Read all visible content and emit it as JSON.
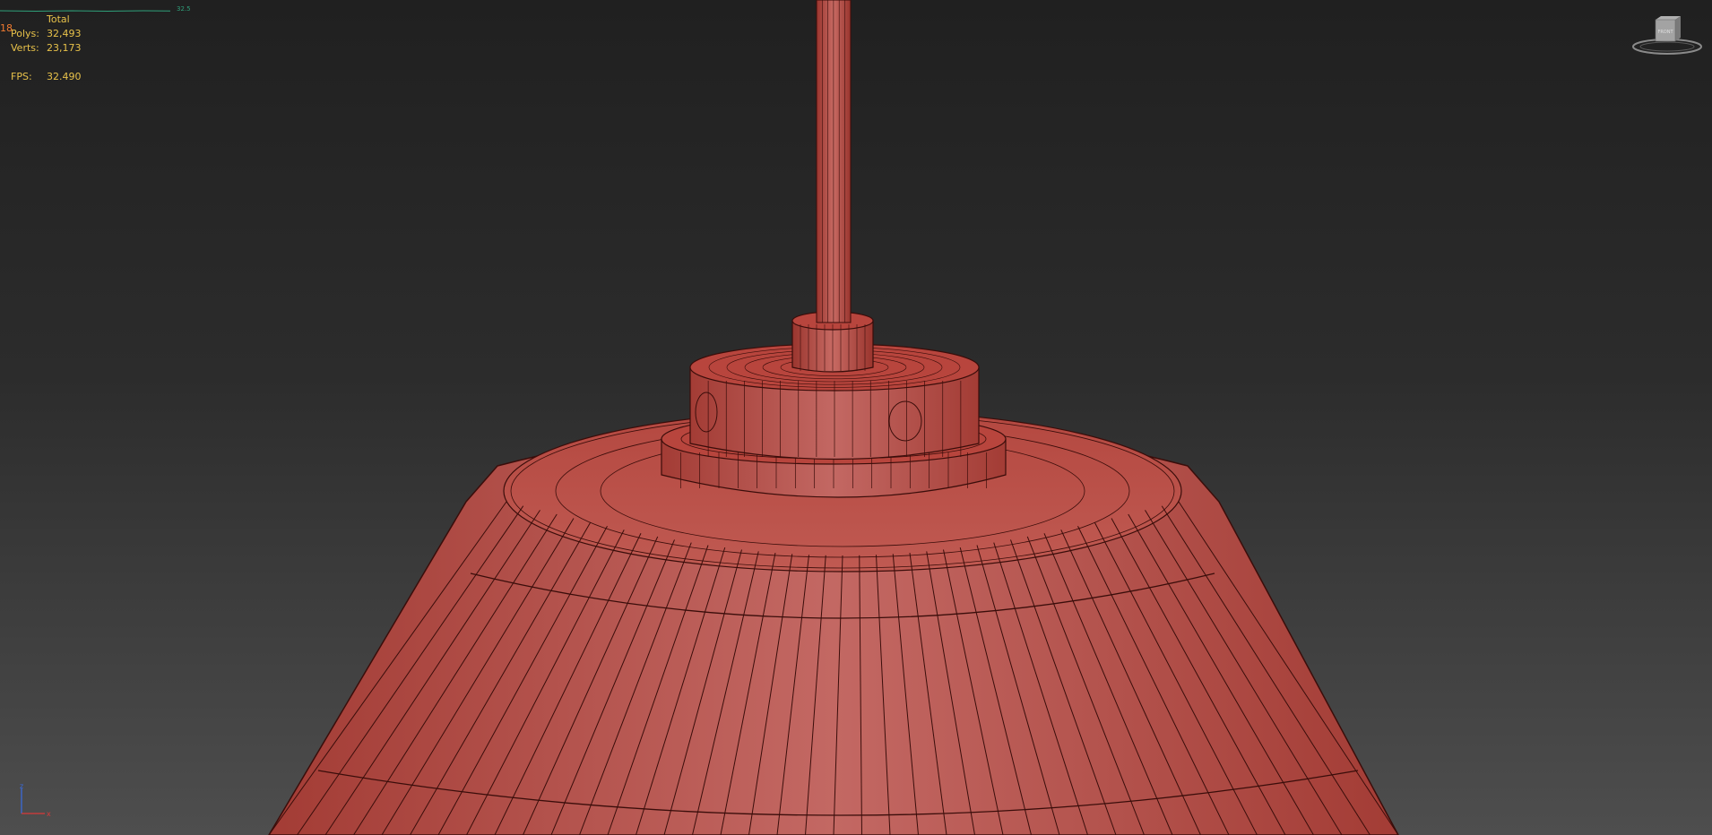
{
  "stats": {
    "graph_value": "32.5",
    "side_number": "18",
    "header": "Total",
    "polys_label": "Polys:",
    "polys_value": "32,493",
    "verts_label": "Verts:",
    "verts_value": "23,173",
    "fps_label": "FPS:",
    "fps_value": "32.490"
  },
  "viewcube": {
    "face_label": "FRONT"
  },
  "axis": {
    "z": "z",
    "x": "x"
  },
  "colors": {
    "model_base": "#b5463f",
    "model_light": "#c86a64",
    "model_dark": "#8a302b",
    "wire": "#3a0d0a",
    "stats_text": "#e8c24a",
    "graph": "#2fa07a",
    "background_top": "#202020",
    "background_bottom": "#4e4e4e"
  }
}
